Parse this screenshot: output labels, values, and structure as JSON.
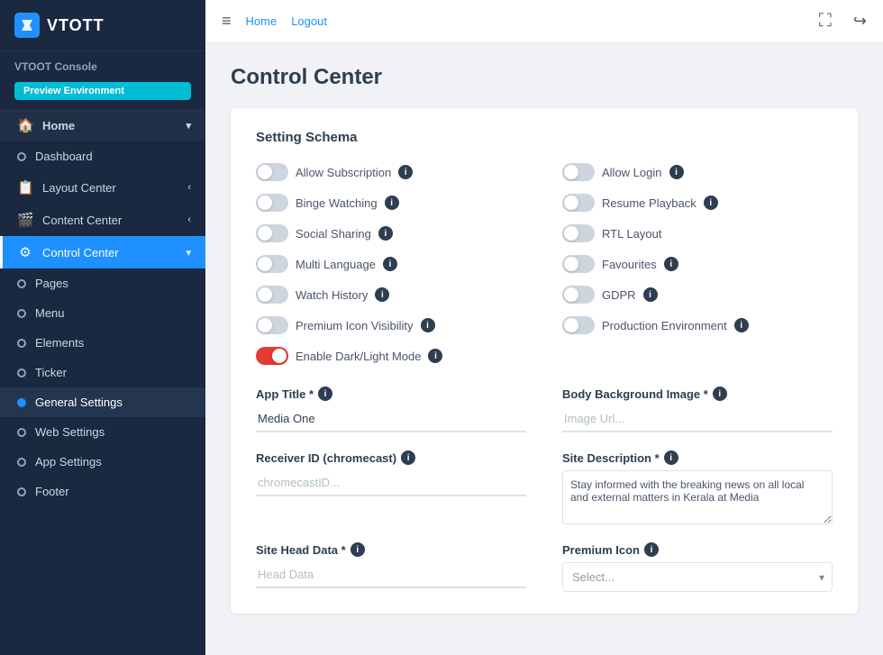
{
  "sidebar": {
    "logo_text": "VTOTT",
    "console_label": "VTOOT Console",
    "env_badge": "Preview Environment",
    "items": [
      {
        "id": "home",
        "label": "Home",
        "icon": "🏠",
        "type": "section",
        "has_chevron": true
      },
      {
        "id": "dashboard",
        "label": "Dashboard",
        "type": "circle"
      },
      {
        "id": "layout-center",
        "label": "Layout Center",
        "icon": "📋",
        "type": "icon",
        "has_chevron": true
      },
      {
        "id": "content-center",
        "label": "Content Center",
        "icon": "🎬",
        "type": "icon",
        "has_chevron": true
      },
      {
        "id": "control-center",
        "label": "Control Center",
        "icon": "⚙",
        "type": "icon",
        "active": true,
        "has_chevron": true
      },
      {
        "id": "pages",
        "label": "Pages",
        "type": "circle"
      },
      {
        "id": "menu",
        "label": "Menu",
        "type": "circle"
      },
      {
        "id": "elements",
        "label": "Elements",
        "type": "circle"
      },
      {
        "id": "ticker",
        "label": "Ticker",
        "type": "circle"
      },
      {
        "id": "general-settings",
        "label": "General Settings",
        "type": "circle",
        "active_sub": true
      },
      {
        "id": "web-settings",
        "label": "Web Settings",
        "type": "circle"
      },
      {
        "id": "app-settings",
        "label": "App Settings",
        "type": "circle"
      },
      {
        "id": "footer",
        "label": "Footer",
        "type": "circle"
      }
    ]
  },
  "topbar": {
    "menu_icon": "≡",
    "home_link": "Home",
    "logout_link": "Logout",
    "fullscreen_icon": "⛶",
    "share_icon": "↪"
  },
  "page": {
    "title": "Control Center",
    "card_title": "Setting Schema"
  },
  "toggles": [
    {
      "id": "allow-subscription",
      "label": "Allow Subscription",
      "on": false
    },
    {
      "id": "allow-login",
      "label": "Allow Login",
      "on": false
    },
    {
      "id": "binge-watching",
      "label": "Binge Watching",
      "on": false
    },
    {
      "id": "resume-playback",
      "label": "Resume Playback",
      "on": false
    },
    {
      "id": "social-sharing",
      "label": "Social Sharing",
      "on": false
    },
    {
      "id": "rtl-layout",
      "label": "RTL Layout",
      "on": false
    },
    {
      "id": "multi-language",
      "label": "Multi Language",
      "on": false
    },
    {
      "id": "favourites",
      "label": "Favourites",
      "on": false
    },
    {
      "id": "watch-history",
      "label": "Watch History",
      "on": false
    },
    {
      "id": "gdpr",
      "label": "GDPR",
      "on": false
    },
    {
      "id": "premium-icon-visibility",
      "label": "Premium Icon Visibility",
      "on": false
    },
    {
      "id": "production-environment",
      "label": "Production Environment",
      "on": false
    },
    {
      "id": "enable-dark-light",
      "label": "Enable Dark/Light Mode",
      "on": true
    }
  ],
  "fields": {
    "app_title_label": "App Title *",
    "app_title_value": "Media One",
    "body_bg_label": "Body Background Image *",
    "body_bg_placeholder": "Image Url...",
    "receiver_id_label": "Receiver ID (chromecast)",
    "receiver_id_placeholder": "chromecastID...",
    "site_description_label": "Site Description *",
    "site_description_value": "Stay informed with the breaking news on all local and external matters in Kerala at Media",
    "site_head_data_label": "Site Head Data *",
    "site_head_data_placeholder": "Head Data",
    "premium_icon_label": "Premium Icon",
    "premium_icon_placeholder": "Select..."
  }
}
